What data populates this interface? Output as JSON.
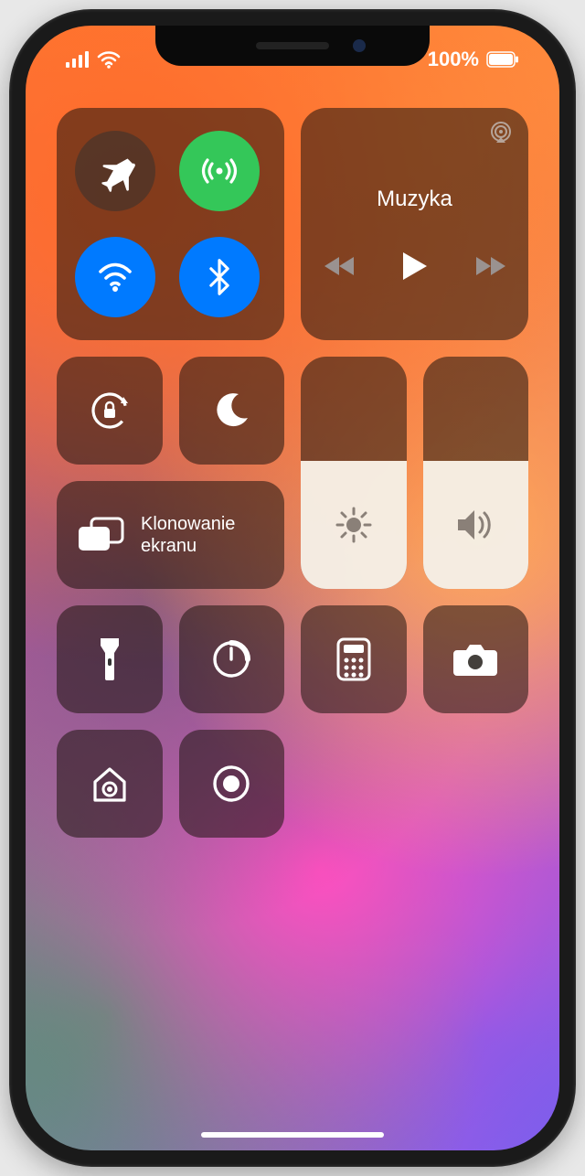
{
  "status": {
    "battery_text": "100%"
  },
  "music": {
    "title": "Muzyka"
  },
  "screen_mirroring": {
    "label_line1": "Klonowanie",
    "label_line2": "ekranu"
  },
  "sliders": {
    "brightness_percent": 55,
    "volume_percent": 55
  },
  "connectivity": {
    "airplane": false,
    "cellular": true,
    "wifi": true,
    "bluetooth": true
  },
  "icons": {
    "orientation_lock": "orientation-lock-icon",
    "dnd": "moon-icon",
    "flashlight": "flashlight-icon",
    "timer": "timer-icon",
    "calculator": "calculator-icon",
    "camera": "camera-icon",
    "home": "home-icon",
    "screen_record": "screen-record-icon"
  }
}
